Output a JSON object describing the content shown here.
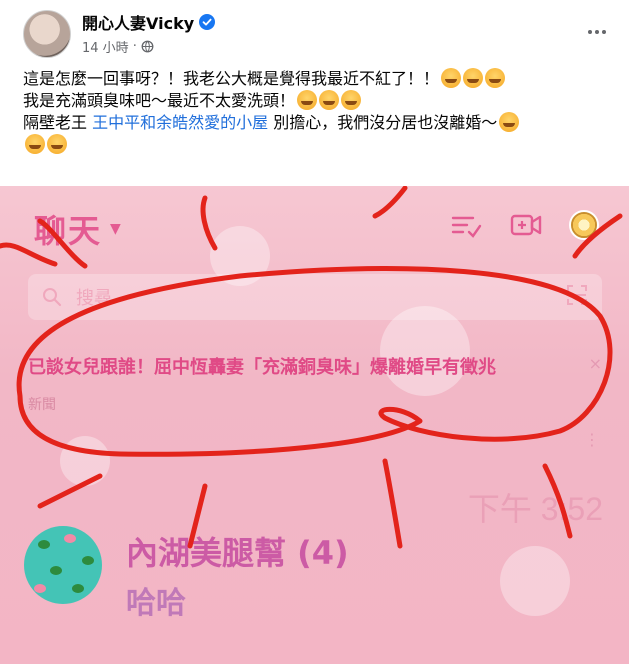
{
  "post": {
    "author": "開心人妻Vicky",
    "time": "14 小時",
    "privacy_separator": "·",
    "lines": {
      "l1": "這是怎麼一回事呀？！我老公大概是覺得我最近不紅了！！",
      "l2": "我是充滿頭臭味吧～最近不太愛洗頭！",
      "l3_prefix": "隔壁老王 ",
      "l3_link": "王中平和余皓然愛的小屋",
      "l3_suffix": " 別擔心，我們沒分居也沒離婚～"
    }
  },
  "screenshot": {
    "chat_title": "聊天",
    "search_placeholder": "搜尋",
    "news": {
      "headline": "已談女兒跟誰！屈中恆轟妻「充滿銅臭味」爆離婚早有徵兆",
      "source": "新聞",
      "close": "×",
      "more": "⋮"
    },
    "time": "下午 3:52",
    "chat": {
      "group_name": "內湖美腿幫 (4)",
      "last_message": "哈哈"
    }
  },
  "colors": {
    "accent_pink": "#e45b92",
    "scribble_red": "#e3231b",
    "link_blue": "#216fdb"
  }
}
